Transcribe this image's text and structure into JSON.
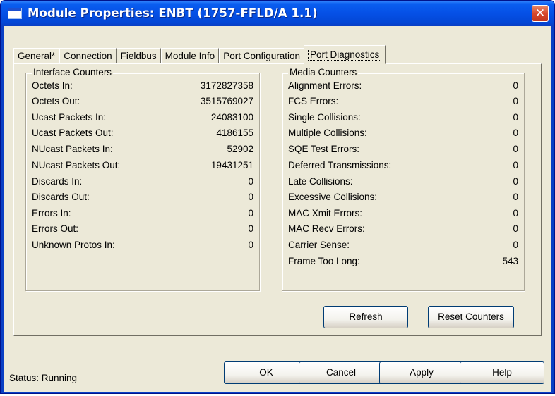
{
  "window": {
    "title": "Module Properties: ENBT (1757-FFLD/A 1.1)",
    "close_glyph": "✕"
  },
  "tabs": [
    {
      "label": "General*"
    },
    {
      "label": "Connection"
    },
    {
      "label": "Fieldbus"
    },
    {
      "label": "Module Info"
    },
    {
      "label": "Port Configuration"
    },
    {
      "label": "Port Diagnostics",
      "active": true
    }
  ],
  "interface_counters": {
    "title": "Interface Counters",
    "rows": [
      {
        "label": "Octets In:",
        "value": "3172827358"
      },
      {
        "label": "Octets Out:",
        "value": "3515769027"
      },
      {
        "label": "Ucast Packets In:",
        "value": "24083100"
      },
      {
        "label": "Ucast Packets Out:",
        "value": "4186155"
      },
      {
        "label": "NUcast Packets In:",
        "value": "52902"
      },
      {
        "label": "NUcast Packets Out:",
        "value": "19431251"
      },
      {
        "label": "Discards In:",
        "value": "0"
      },
      {
        "label": "Discards Out:",
        "value": "0"
      },
      {
        "label": "Errors In:",
        "value": "0"
      },
      {
        "label": "Errors Out:",
        "value": "0"
      },
      {
        "label": "Unknown Protos In:",
        "value": "0"
      }
    ]
  },
  "media_counters": {
    "title": "Media Counters",
    "rows": [
      {
        "label": "Alignment Errors:",
        "value": "0"
      },
      {
        "label": "FCS Errors:",
        "value": "0"
      },
      {
        "label": "Single Collisions:",
        "value": "0"
      },
      {
        "label": "Multiple Collisions:",
        "value": "0"
      },
      {
        "label": "SQE Test Errors:",
        "value": "0"
      },
      {
        "label": "Deferred Transmissions:",
        "value": "0"
      },
      {
        "label": "Late Collisions:",
        "value": "0"
      },
      {
        "label": "Excessive Collisions:",
        "value": "0"
      },
      {
        "label": "MAC Xmit Errors:",
        "value": "0"
      },
      {
        "label": "MAC Recv Errors:",
        "value": "0"
      },
      {
        "label": "Carrier Sense:",
        "value": "0"
      },
      {
        "label": "Frame Too Long:",
        "value": "543"
      }
    ]
  },
  "panel_buttons": {
    "refresh_pre": "",
    "refresh_key": "R",
    "refresh_post": "efresh",
    "reset_pre": "Reset ",
    "reset_key": "C",
    "reset_post": "ounters"
  },
  "footer": {
    "status": "Status:  Running",
    "ok": "OK",
    "cancel": "Cancel",
    "apply": "Apply",
    "help": "Help"
  }
}
